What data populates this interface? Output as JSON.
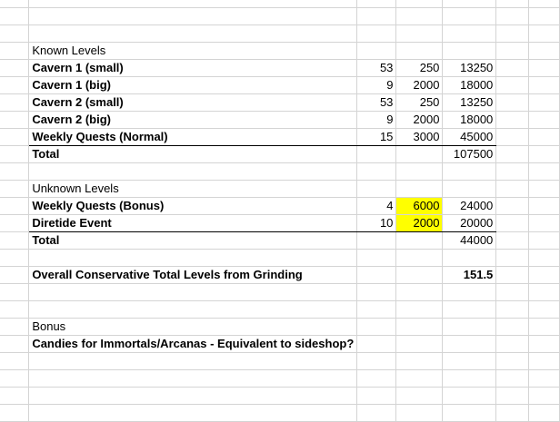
{
  "highlight_color": "#ffff00",
  "rows": [
    {
      "a": "",
      "b": "",
      "c": "",
      "d": "",
      "e": ""
    },
    {
      "a": "",
      "b": "",
      "c": "",
      "d": "",
      "e": ""
    },
    {
      "a": "",
      "b": "",
      "c": "",
      "d": "",
      "e": ""
    },
    {
      "a": "",
      "b": "Known Levels",
      "c": "",
      "d": "",
      "e": ""
    },
    {
      "b": "Cavern 1 (small)",
      "bold": true,
      "c": "53",
      "d": "250",
      "e": "13250"
    },
    {
      "b": "Cavern 1 (big)",
      "bold": true,
      "c": "9",
      "d": "2000",
      "e": "18000"
    },
    {
      "b": "Cavern 2 (small)",
      "bold": true,
      "c": "53",
      "d": "250",
      "e": "13250"
    },
    {
      "b": "Cavern 2 (big)",
      "bold": true,
      "c": "9",
      "d": "2000",
      "e": "18000"
    },
    {
      "b": "Weekly Quests (Normal)",
      "bold": true,
      "c": "15",
      "d": "3000",
      "e": "45000",
      "underline": true
    },
    {
      "b": "Total",
      "bold": true,
      "c": "",
      "d": "",
      "e": "107500"
    },
    {
      "b": "",
      "c": "",
      "d": "",
      "e": ""
    },
    {
      "b": "Unknown Levels",
      "c": "",
      "d": "",
      "e": ""
    },
    {
      "b": "Weekly Quests (Bonus)",
      "bold": true,
      "c": "4",
      "d": "6000",
      "e": "24000",
      "hl": true
    },
    {
      "b": "Diretide Event",
      "bold": true,
      "c": "10",
      "d": "2000",
      "e": "20000",
      "hl": true,
      "underline": true
    },
    {
      "b": "Total",
      "bold": true,
      "c": "",
      "d": "",
      "e": "44000"
    },
    {
      "b": "",
      "c": "",
      "d": "",
      "e": ""
    },
    {
      "b": "Overall Conservative Total Levels from Grinding",
      "bold": true,
      "c": "",
      "d": "",
      "e": "151.5",
      "ebold": true
    },
    {
      "b": "",
      "c": "",
      "d": "",
      "e": ""
    },
    {
      "b": "",
      "c": "",
      "d": "",
      "e": ""
    },
    {
      "b": "Bonus",
      "c": "",
      "d": "",
      "e": ""
    },
    {
      "b": "Candies for Immortals/Arcanas - Equivalent to sideshop?",
      "bold": true,
      "c": "",
      "d": "",
      "e": ""
    },
    {
      "b": "",
      "c": "",
      "d": "",
      "e": ""
    },
    {
      "b": "",
      "c": "",
      "d": "",
      "e": ""
    },
    {
      "b": "",
      "c": "",
      "d": "",
      "e": ""
    },
    {
      "b": "",
      "c": "",
      "d": "",
      "e": ""
    }
  ]
}
